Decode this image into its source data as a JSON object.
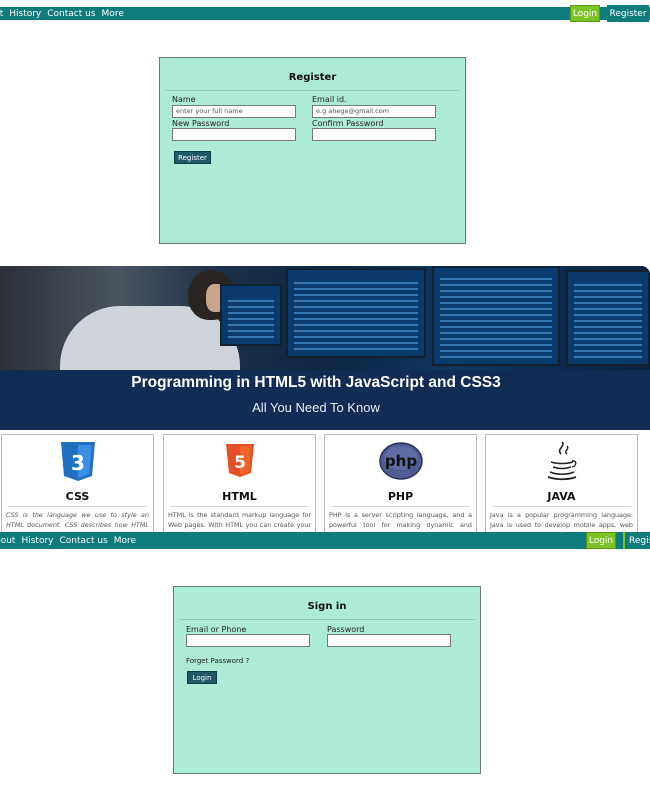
{
  "nav_top": {
    "links": [
      "ut",
      "History",
      "Contact us",
      "More"
    ],
    "login": "Login",
    "register": "Register"
  },
  "register_form": {
    "title": "Register",
    "name_label": "Name",
    "name_placeholder": "enter your full name",
    "email_label": "Email id.",
    "email_placeholder": "e.g ahege@gmail.com",
    "new_password_label": "New Password",
    "confirm_password_label": "Confirm Password",
    "submit": "Register"
  },
  "banner": {
    "heading": "Programming in HTML5 with JavaScript and CSS3",
    "subheading": "All You Need To Know"
  },
  "features": [
    {
      "name": "CSS",
      "icon": "css3-icon",
      "desc": "CSS is the language we use to style an HTML document. CSS describes how HTML elements should be displayed."
    },
    {
      "name": "HTML",
      "icon": "html5-icon",
      "desc": "HTML is the standard markup language for Web pages. With HTML you can create your own Website ... more"
    },
    {
      "name": "PHP",
      "icon": "php-icon",
      "desc": "PHP is a server scripting language, and a powerful tool for making dynamic and interactive Web pages. PHP is a widely"
    },
    {
      "name": "JAVA",
      "icon": "java-icon",
      "desc": "Java is a popular programming language. Java is used to develop mobile apps, web apps, desktop apps, games and much"
    }
  ],
  "nav_bottom": {
    "links": [
      "bout",
      "History",
      "Contact us",
      "More"
    ],
    "login": "Login",
    "register": "Regis"
  },
  "signin_form": {
    "title": "Sign in",
    "email_label": "Email or Phone",
    "password_label": "Password",
    "forgot": "Forget Password ?",
    "submit": "Login"
  },
  "colors": {
    "nav": "#0f7b7a",
    "login_button": "#7cc326",
    "form_bg": "#acebd5",
    "form_button": "#1d5a66"
  }
}
